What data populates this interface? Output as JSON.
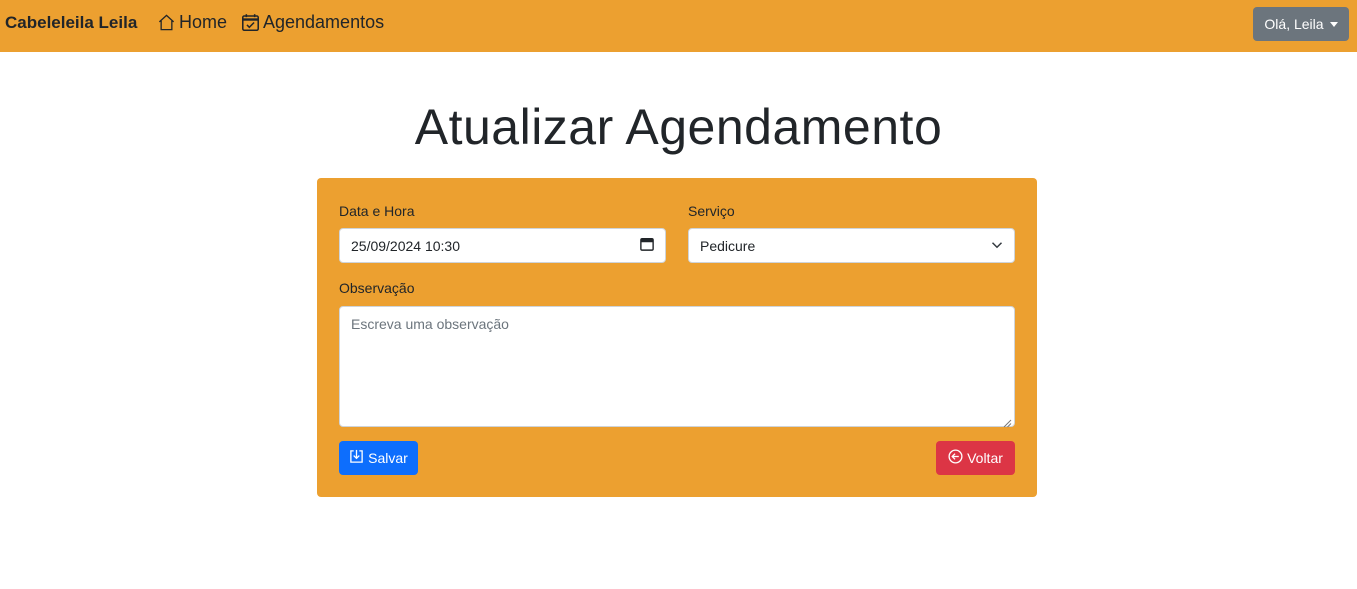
{
  "navbar": {
    "brand": "Cabeleleila Leila",
    "links": [
      {
        "label": "Home",
        "icon": "house-icon"
      },
      {
        "label": "Agendamentos",
        "icon": "calendar-check-icon"
      }
    ],
    "user_menu": {
      "label": "Olá, Leila",
      "icon": "caret-down-icon"
    },
    "background_color": "#eca030"
  },
  "main": {
    "title": "Atualizar Agendamento",
    "form": {
      "date_label": "Data e Hora",
      "date_value": "25/09/2024 10:30",
      "service_label": "Serviço",
      "service_selected": "Pedicure",
      "observation_label": "Observação",
      "observation_placeholder": "Escreva uma observação",
      "observation_value": "",
      "save_button": {
        "label": "Salvar",
        "icon": "download-box-icon",
        "color": "#0d6efd"
      },
      "back_button": {
        "label": "Voltar",
        "icon": "arrow-left-circle-icon",
        "color": "#dc3545"
      }
    }
  }
}
